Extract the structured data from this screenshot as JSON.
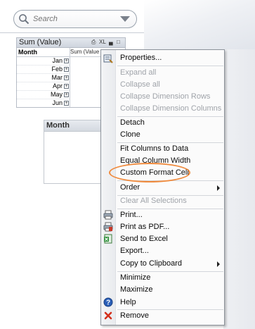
{
  "search": {
    "placeholder": "Search"
  },
  "pivot": {
    "title": "Sum (Value)",
    "xl_label": "XL",
    "dimension_header": "Month",
    "expression_header": "Sum (Value",
    "rows": [
      "Jan",
      "Feb",
      "Mar",
      "Apr",
      "May",
      "Jun"
    ]
  },
  "listbox": {
    "title": "Month"
  },
  "menu": {
    "items": [
      {
        "label": "Properties...",
        "enabled": true,
        "icon": "properties-icon"
      },
      {
        "label": "Expand all",
        "enabled": false
      },
      {
        "label": "Collapse all",
        "enabled": false
      },
      {
        "label": "Collapse Dimension Rows",
        "enabled": false
      },
      {
        "label": "Collapse Dimension Columns",
        "enabled": false
      },
      {
        "label": "Detach",
        "enabled": true
      },
      {
        "label": "Clone",
        "enabled": true
      },
      {
        "label": "Fit Columns to Data",
        "enabled": true
      },
      {
        "label": "Equal Column Width",
        "enabled": true
      },
      {
        "label": "Custom Format Cell",
        "enabled": true,
        "highlighted": true
      },
      {
        "label": "Order",
        "enabled": true,
        "submenu": true
      },
      {
        "label": "Clear All Selections",
        "enabled": false
      },
      {
        "label": "Print...",
        "enabled": true,
        "icon": "print-icon"
      },
      {
        "label": "Print as PDF...",
        "enabled": true,
        "icon": "print-pdf-icon"
      },
      {
        "label": "Send to Excel",
        "enabled": true,
        "icon": "excel-icon"
      },
      {
        "label": "Export...",
        "enabled": true
      },
      {
        "label": "Copy to Clipboard",
        "enabled": true,
        "submenu": true
      },
      {
        "label": "Minimize",
        "enabled": true
      },
      {
        "label": "Maximize",
        "enabled": true
      },
      {
        "label": "Help",
        "enabled": true,
        "icon": "help-icon"
      },
      {
        "label": "Remove",
        "enabled": true,
        "icon": "remove-icon"
      }
    ]
  },
  "colors": {
    "highlight_ring": "#f08a3c",
    "disabled_text": "#a0a4aa"
  }
}
